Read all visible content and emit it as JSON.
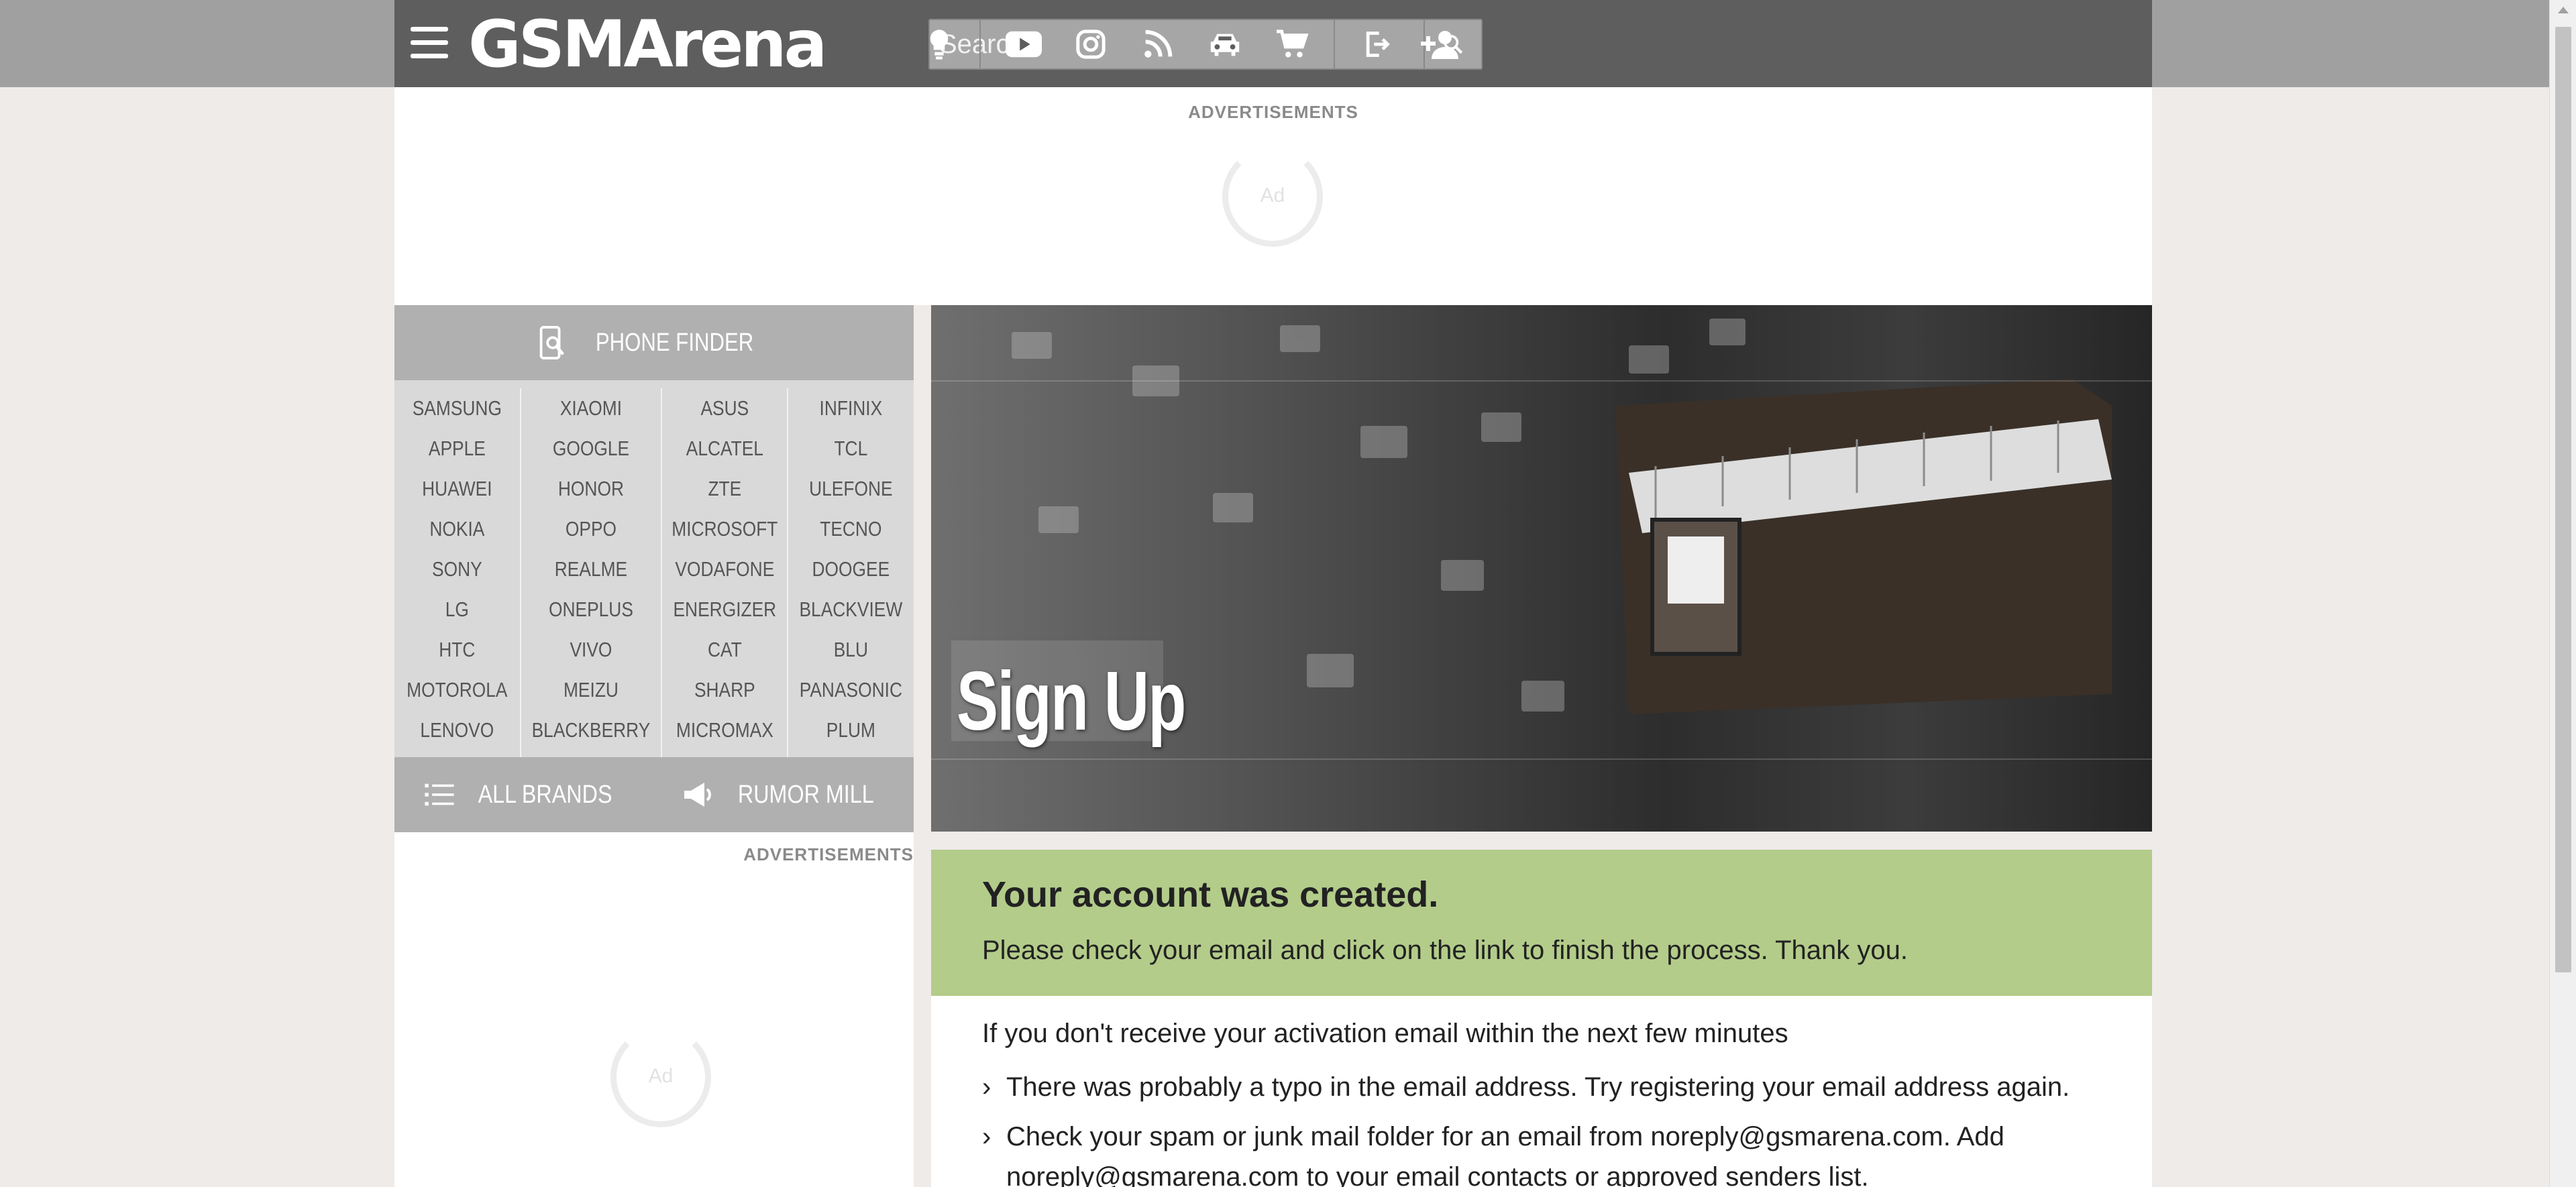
{
  "header": {
    "logo_text": "GSMArena",
    "search_placeholder": "Search",
    "icons": [
      "menu-icon",
      "search-icon",
      "lightbulb-icon",
      "youtube-icon",
      "instagram-icon",
      "rss-icon",
      "car-icon",
      "cart-icon",
      "login-icon",
      "add-user-icon"
    ]
  },
  "ads": {
    "top_label": "ADVERTISEMENTS",
    "left_label": "ADVERTISEMENTS",
    "placeholder": "Ad"
  },
  "sidebar": {
    "phone_finder": "PHONE FINDER",
    "brands": [
      [
        "SAMSUNG",
        "APPLE",
        "HUAWEI",
        "NOKIA",
        "SONY",
        "LG",
        "HTC",
        "MOTOROLA",
        "LENOVO"
      ],
      [
        "XIAOMI",
        "GOOGLE",
        "HONOR",
        "OPPO",
        "REALME",
        "ONEPLUS",
        "VIVO",
        "MEIZU",
        "BLACKBERRY"
      ],
      [
        "ASUS",
        "ALCATEL",
        "ZTE",
        "MICROSOFT",
        "VODAFONE",
        "ENERGIZER",
        "CAT",
        "SHARP",
        "MICROMAX"
      ],
      [
        "INFINIX",
        "TCL",
        "ULEFONE",
        "TECNO",
        "DOOGEE",
        "BLACKVIEW",
        "BLU",
        "PANASONIC",
        "PLUM"
      ]
    ],
    "all_brands": "ALL BRANDS",
    "rumor_mill": "RUMOR MILL"
  },
  "main": {
    "hero_title": "Sign Up",
    "success_title": "Your account was created.",
    "success_text": "Please check your email and click on the link to finish the process. Thank you.",
    "info_lead": "If you don't receive your activation email within the next few minutes",
    "info_items": [
      "There was probably a typo in the email address. Try registering your email address again.",
      "Check your spam or junk mail folder for an email from noreply@gsmarena.com. Add noreply@gsmarena.com to your email contacts or approved senders list."
    ]
  },
  "colors": {
    "header_bg": "#5e5e5e",
    "success_bg": "#b3cc8a",
    "sidebar_bg": "#d9d9d9"
  }
}
